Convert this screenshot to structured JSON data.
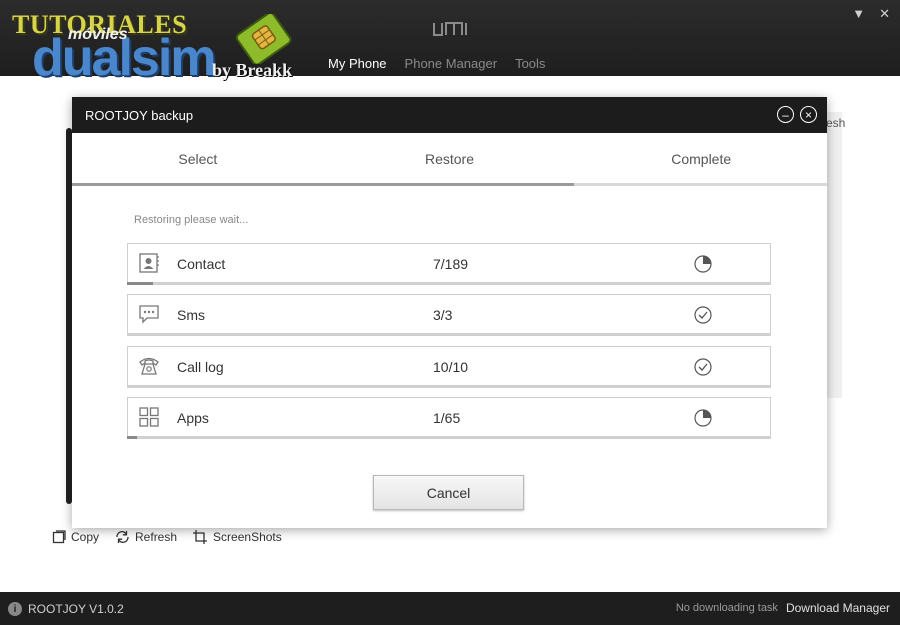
{
  "logo": {
    "line1": "TUTORIALES",
    "line2": "móviles",
    "line3": "dualsim",
    "line4": "by Breakk"
  },
  "brand": "UMI",
  "nav": [
    "My Phone",
    "Phone Manager",
    "Tools"
  ],
  "nav_active": "My Phone",
  "bg": {
    "right_fragment": "esh"
  },
  "bottom_actions": {
    "copy": "Copy",
    "refresh": "Refresh",
    "screenshots": "ScreenShots"
  },
  "status": {
    "version": "ROOTJOY V1.0.2",
    "task": "No downloading task",
    "download_manager": "Download Manager"
  },
  "dialog": {
    "title": "ROOTJOY backup",
    "steps": [
      "Select",
      "Restore",
      "Complete"
    ],
    "current_step": "Restore",
    "wait_text": "Restoring please wait...",
    "items": [
      {
        "name": "Contact",
        "count": "7/189",
        "icon": "contact-icon",
        "status": "in-progress",
        "progress": 0.04
      },
      {
        "name": "Sms",
        "count": "3/3",
        "icon": "sms-icon",
        "status": "complete",
        "progress": 0
      },
      {
        "name": "Call log",
        "count": "10/10",
        "icon": "phone-icon",
        "status": "complete",
        "progress": 0
      },
      {
        "name": "Apps",
        "count": "1/65",
        "icon": "apps-icon",
        "status": "in-progress",
        "progress": 0.015
      }
    ],
    "cancel_label": "Cancel"
  }
}
